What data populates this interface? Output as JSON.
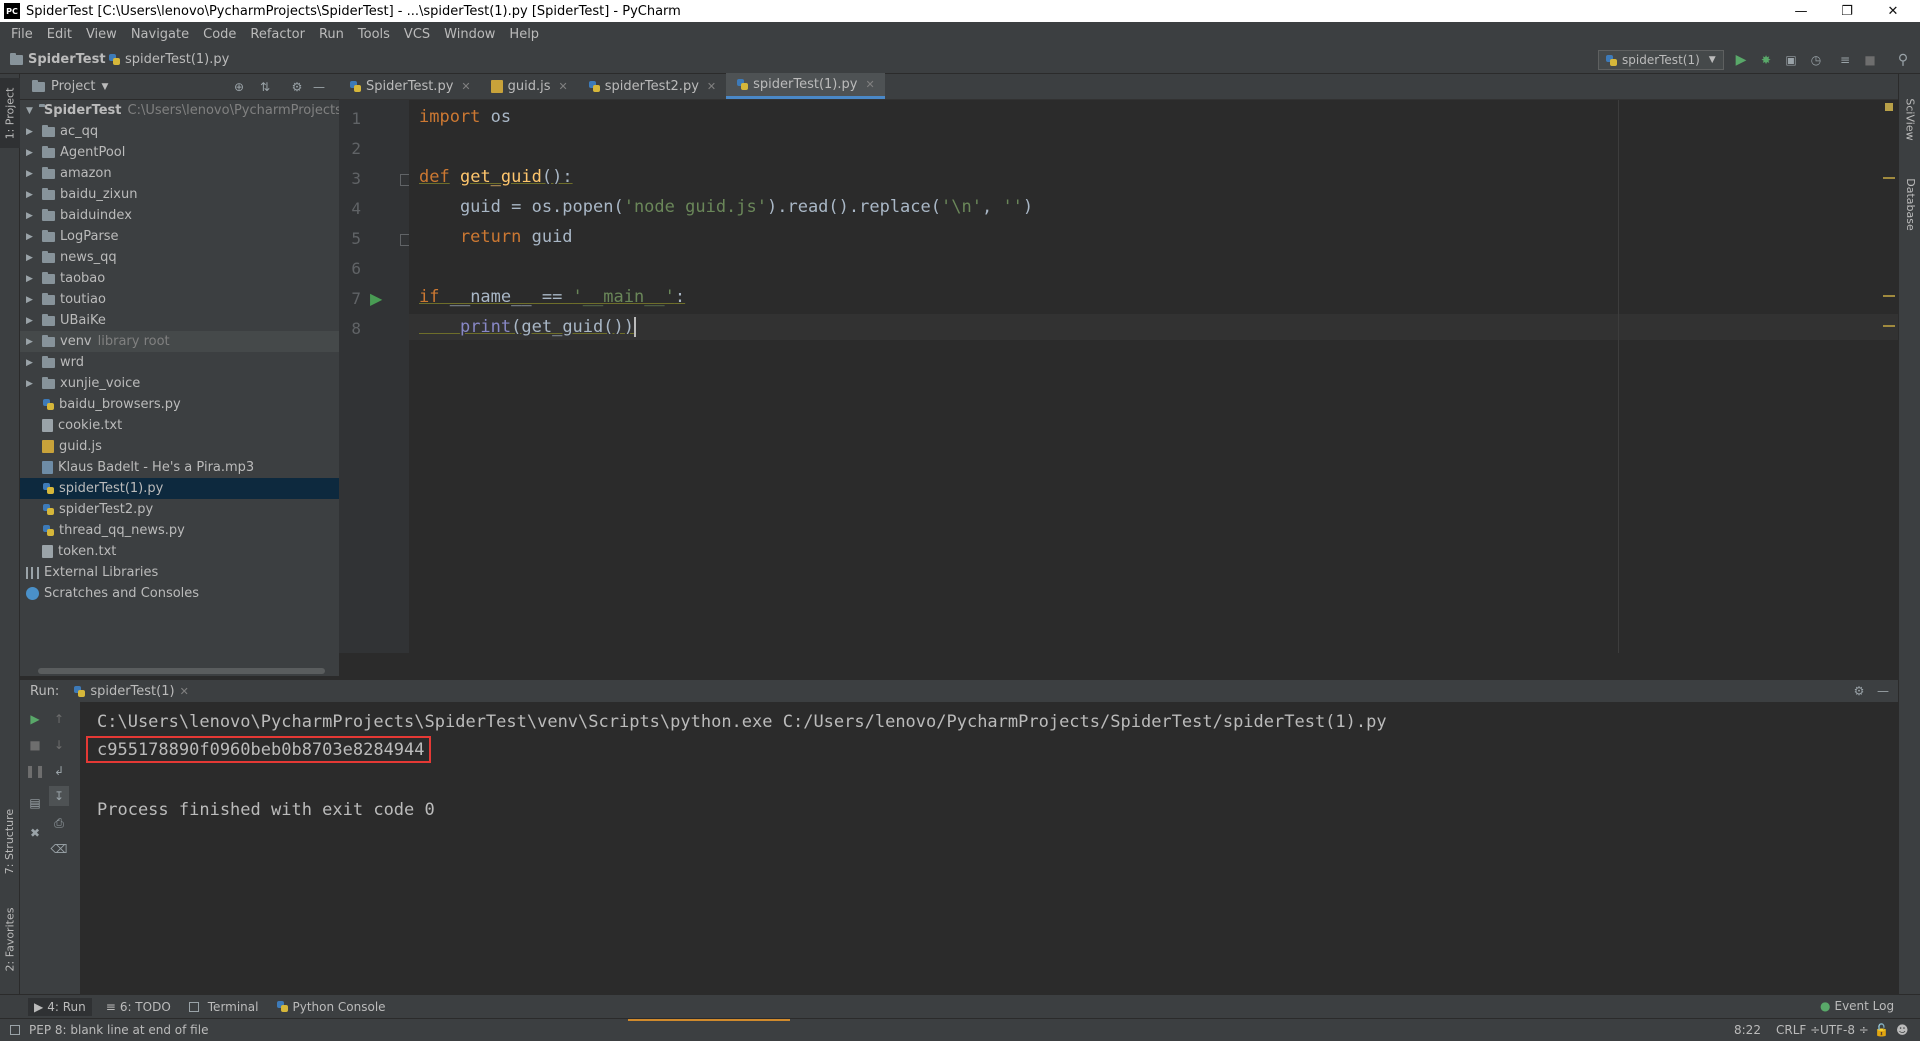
{
  "window": {
    "title": "SpiderTest [C:\\Users\\lenovo\\PycharmProjects\\SpiderTest] - ...\\spiderTest(1).py [SpiderTest] - PyCharm"
  },
  "menu": [
    "File",
    "Edit",
    "View",
    "Navigate",
    "Code",
    "Refactor",
    "Run",
    "Tools",
    "VCS",
    "Window",
    "Help"
  ],
  "nav": {
    "project": "SpiderTest",
    "file": "spiderTest(1).py",
    "run_config": "spiderTest(1)"
  },
  "left_stripe": {
    "project_tab": "1: Project",
    "structure_tab": "7: Structure",
    "favorites_tab": "2: Favorites"
  },
  "right_stripe": {
    "sciview_tab": "SciView",
    "database_tab": "Database"
  },
  "project_panel": {
    "title": "Project",
    "root": {
      "name": "SpiderTest",
      "path": "C:\\Users\\lenovo\\PycharmProjects\\Spid"
    },
    "folders": [
      "ac_qq",
      "AgentPool",
      "amazon",
      "baidu_zixun",
      "baiduindex",
      "LogParse",
      "news_qq",
      "taobao",
      "toutiao",
      "UBaiKe",
      "venv",
      "wrd",
      "xunjie_voice"
    ],
    "venv_note": "library root",
    "files": [
      {
        "name": "baidu_browsers.py",
        "type": "py"
      },
      {
        "name": "cookie.txt",
        "type": "txt"
      },
      {
        "name": "guid.js",
        "type": "js"
      },
      {
        "name": "Klaus Badelt - He's a Pira.mp3",
        "type": "mp3"
      },
      {
        "name": "spiderTest(1).py",
        "type": "py"
      },
      {
        "name": "spiderTest2.py",
        "type": "py"
      },
      {
        "name": "thread_qq_news.py",
        "type": "py"
      },
      {
        "name": "token.txt",
        "type": "txt"
      }
    ],
    "external": "External Libraries",
    "scratches": "Scratches and Consoles"
  },
  "editor_tabs": [
    "SpiderTest.py",
    "guid.js",
    "spiderTest2.py",
    "spiderTest(1).py"
  ],
  "active_tab": 3,
  "code": {
    "line_numbers": [
      "1",
      "2",
      "3",
      "4",
      "5",
      "6",
      "7",
      "8"
    ],
    "l1_kw": "import",
    "l1_rest": " os",
    "l3_kw": "def",
    "l3_fn": "get_guid",
    "l3_rest": "():",
    "l4_a": "    guid = os.popen(",
    "l4_s1": "'node guid.js'",
    "l4_b": ").read().replace(",
    "l4_s2": "'\\n'",
    "l4_c": ", ",
    "l4_s3": "''",
    "l4_d": ")",
    "l5_kw": "    return",
    "l5_rest": " guid",
    "l7_kw": "if",
    "l7_a": " __name__ == ",
    "l7_s": "'__main__'",
    "l7_b": ":",
    "l8_pre": "    ",
    "l8_bi": "print",
    "l8_rest": "(get_guid())"
  },
  "run": {
    "label": "Run:",
    "tab": "spiderTest(1)",
    "output": [
      "C:\\Users\\lenovo\\PycharmProjects\\SpiderTest\\venv\\Scripts\\python.exe C:/Users/lenovo/PycharmProjects/SpiderTest/spiderTest(1).py",
      "c955178890f0960beb0b8703e8284944",
      "",
      "Process finished with exit code 0"
    ]
  },
  "bottom_tools": [
    "4: Run",
    "6: TODO",
    "Terminal",
    "Python Console"
  ],
  "event_log": "Event Log",
  "status": {
    "message": "PEP 8: blank line at end of file",
    "position": "8:22",
    "line_sep": "CRLF ÷",
    "encoding": "UTF-8 ÷"
  },
  "colors": {
    "keyword": "#cc7832",
    "function": "#ffc66d",
    "string": "#6a8759",
    "builtin": "#8888c6",
    "highlight_box": "#e53935",
    "selection": "#0d293e"
  }
}
